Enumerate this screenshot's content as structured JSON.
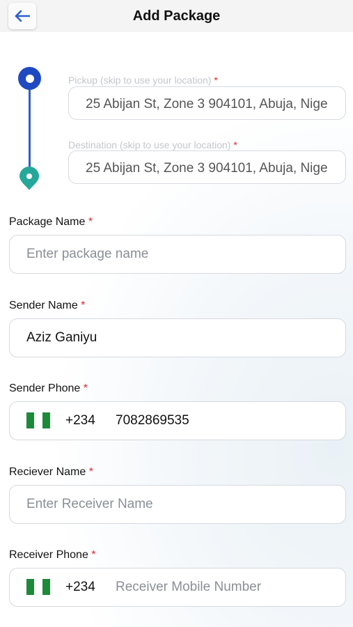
{
  "header": {
    "title": "Add Package",
    "back_icon": "arrow-left-icon"
  },
  "route": {
    "pickup_label": "Pickup (skip to use your location)",
    "pickup_value": "25 Abijan St, Zone 3 904101, Abuja, Nige",
    "destination_label": "Destination (skip to use your location)",
    "destination_value": "25 Abijan St, Zone 3 904101, Abuja, Nige",
    "line_color": "#2f5dcf",
    "pickup_color": "#1f49c1",
    "destination_color": "#25a89a"
  },
  "required_mark": "*",
  "package_name": {
    "label": "Package Name",
    "placeholder": "Enter package name",
    "value": ""
  },
  "sender_name": {
    "label": "Sender Name",
    "value": "Aziz Ganiyu"
  },
  "sender_phone": {
    "label": "Sender Phone",
    "country_code": "+234",
    "value": "7082869535",
    "flag": "nigeria-flag-icon"
  },
  "receiver_name": {
    "label": "Reciever Name",
    "placeholder": "Enter Receiver Name",
    "value": ""
  },
  "receiver_phone": {
    "label": "Receiver Phone",
    "country_code": "+234",
    "placeholder": "Receiver Mobile Number",
    "value": "",
    "flag": "nigeria-flag-icon"
  }
}
